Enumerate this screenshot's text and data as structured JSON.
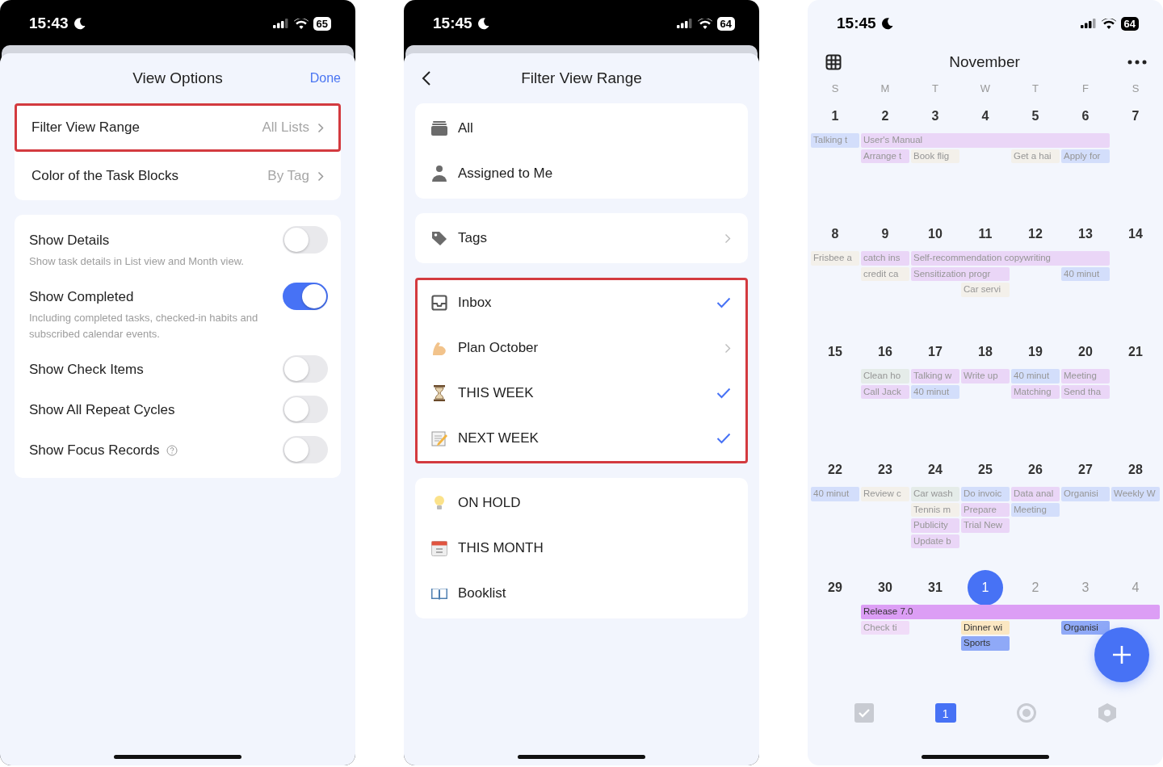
{
  "view_options": {
    "status_bar": {
      "time": "15:43",
      "battery": "65"
    },
    "title": "View Options",
    "done": "Done",
    "nav_rows": [
      {
        "label": "Filter View Range",
        "value": "All Lists",
        "highlighted": true
      },
      {
        "label": "Color of the Task Blocks",
        "value": "By Tag",
        "highlighted": false
      }
    ],
    "toggles": [
      {
        "label": "Show Details",
        "description": "Show task details in List view and Month view.",
        "on": false,
        "help": false
      },
      {
        "label": "Show Completed",
        "description": "Including completed tasks, checked-in habits and subscribed calendar events.",
        "on": true,
        "help": false
      },
      {
        "label": "Show Check Items",
        "on": false,
        "help": false
      },
      {
        "label": "Show All Repeat Cycles",
        "on": false,
        "help": false
      },
      {
        "label": "Show Focus Records",
        "on": false,
        "help": true
      }
    ]
  },
  "filter_view_range": {
    "status_bar": {
      "time": "15:45",
      "battery": "64"
    },
    "title": "Filter View Range",
    "groups": [
      {
        "highlighted": false,
        "items": [
          {
            "label": "All",
            "kind": "stack",
            "expandable": false,
            "selected": false
          },
          {
            "label": "Assigned to Me",
            "kind": "person",
            "expandable": false,
            "selected": false
          }
        ]
      },
      {
        "highlighted": false,
        "items": [
          {
            "label": "Tags",
            "kind": "tag",
            "expandable": true,
            "selected": false
          }
        ]
      },
      {
        "highlighted": true,
        "items": [
          {
            "label": "Inbox",
            "kind": "inbox",
            "expandable": false,
            "selected": true
          },
          {
            "label": "Plan October",
            "kind": "arm",
            "expandable": true,
            "selected": false
          },
          {
            "label": "THIS WEEK",
            "kind": "hourglass",
            "expandable": false,
            "selected": true
          },
          {
            "label": "NEXT WEEK",
            "kind": "memo",
            "expandable": false,
            "selected": true
          }
        ]
      },
      {
        "highlighted": false,
        "items": [
          {
            "label": "ON HOLD",
            "kind": "bulb",
            "expandable": false,
            "selected": false
          },
          {
            "label": "THIS MONTH",
            "kind": "calendar",
            "expandable": false,
            "selected": false
          },
          {
            "label": "Booklist",
            "kind": "book",
            "expandable": false,
            "selected": false
          }
        ]
      }
    ]
  },
  "calendar": {
    "status_bar": {
      "time": "15:45",
      "battery": "64"
    },
    "month": "November",
    "weekdays": [
      "S",
      "M",
      "T",
      "W",
      "T",
      "F",
      "S"
    ],
    "weeks": [
      {
        "days": [
          {
            "label": "1",
            "muted": false,
            "today": false
          },
          {
            "label": "2",
            "muted": false,
            "today": false
          },
          {
            "label": "3",
            "muted": false,
            "today": false
          },
          {
            "label": "4",
            "muted": false,
            "today": false
          },
          {
            "label": "5",
            "muted": false,
            "today": false
          },
          {
            "label": "6",
            "muted": false,
            "today": false
          },
          {
            "label": "7",
            "muted": false,
            "today": false
          }
        ],
        "lanes": [
          [
            {
              "kind": "event",
              "title": "Talking t",
              "color": "#d3defb",
              "completed": true
            },
            {
              "kind": "event",
              "title": "User's Manual",
              "color": "#ead6f7",
              "completed": true
            },
            {
              "kind": "continued"
            },
            {
              "kind": "continued"
            },
            {
              "kind": "continued"
            },
            {
              "kind": "continued"
            },
            {
              "kind": "empty"
            }
          ],
          [
            {
              "kind": "empty"
            },
            {
              "kind": "event",
              "title": "Arrange t",
              "color": "#ead6f7",
              "completed": true
            },
            {
              "kind": "event",
              "title": "Book flig",
              "color": "#f3f0ea",
              "completed": true
            },
            {
              "kind": "empty"
            },
            {
              "kind": "event",
              "title": "Get a hai",
              "color": "#f3f0ea",
              "completed": true
            },
            {
              "kind": "event",
              "title": "Apply for",
              "color": "#d3defb",
              "completed": true
            },
            {
              "kind": "empty"
            }
          ]
        ]
      },
      {
        "days": [
          {
            "label": "8",
            "muted": false,
            "today": false
          },
          {
            "label": "9",
            "muted": false,
            "today": false
          },
          {
            "label": "10",
            "muted": false,
            "today": false
          },
          {
            "label": "11",
            "muted": false,
            "today": false
          },
          {
            "label": "12",
            "muted": false,
            "today": false
          },
          {
            "label": "13",
            "muted": false,
            "today": false
          },
          {
            "label": "14",
            "muted": false,
            "today": false
          }
        ],
        "lanes": [
          [
            {
              "kind": "event",
              "title": "Frisbee a",
              "color": "#f3f0ea",
              "completed": true
            },
            {
              "kind": "event",
              "title": "catch ins",
              "color": "#ead6f7",
              "completed": true
            },
            {
              "kind": "event",
              "title": "Self-recommendation copywriting",
              "color": "#ead6f7",
              "completed": true
            },
            {
              "kind": "continued"
            },
            {
              "kind": "continued"
            },
            {
              "kind": "continued"
            },
            {
              "kind": "empty"
            }
          ],
          [
            {
              "kind": "empty"
            },
            {
              "kind": "event",
              "title": "credit ca",
              "color": "#f3f0ea",
              "completed": true
            },
            {
              "kind": "event",
              "title": "Sensitization progr",
              "color": "#ead6f7",
              "completed": true
            },
            {
              "kind": "continued"
            },
            {
              "kind": "empty"
            },
            {
              "kind": "event",
              "title": "40 minut",
              "color": "#d3defb",
              "completed": true
            },
            {
              "kind": "empty"
            }
          ],
          [
            {
              "kind": "empty"
            },
            {
              "kind": "empty"
            },
            {
              "kind": "empty"
            },
            {
              "kind": "event",
              "title": "Car servi",
              "color": "#f3f0ea",
              "completed": true
            },
            {
              "kind": "empty"
            },
            {
              "kind": "empty"
            },
            {
              "kind": "empty"
            }
          ]
        ]
      },
      {
        "days": [
          {
            "label": "15",
            "muted": false,
            "today": false
          },
          {
            "label": "16",
            "muted": false,
            "today": false
          },
          {
            "label": "17",
            "muted": false,
            "today": false
          },
          {
            "label": "18",
            "muted": false,
            "today": false
          },
          {
            "label": "19",
            "muted": false,
            "today": false
          },
          {
            "label": "20",
            "muted": false,
            "today": false
          },
          {
            "label": "21",
            "muted": false,
            "today": false
          }
        ],
        "lanes": [
          [
            {
              "kind": "empty"
            },
            {
              "kind": "event",
              "title": "Clean ho",
              "color": "#e5ece9",
              "completed": true
            },
            {
              "kind": "event",
              "title": "Talking w",
              "color": "#ead6f7",
              "completed": true
            },
            {
              "kind": "event",
              "title": "Write up",
              "color": "#ead6f7",
              "completed": true
            },
            {
              "kind": "event",
              "title": "40 minut",
              "color": "#d3defb",
              "completed": true
            },
            {
              "kind": "event",
              "title": "Meeting",
              "color": "#ead6f7",
              "completed": true
            },
            {
              "kind": "empty"
            }
          ],
          [
            {
              "kind": "empty"
            },
            {
              "kind": "event",
              "title": "Call Jack",
              "color": "#ead6f7",
              "completed": true
            },
            {
              "kind": "event",
              "title": "40 minut",
              "color": "#d3defb",
              "completed": true
            },
            {
              "kind": "empty"
            },
            {
              "kind": "event",
              "title": "Matching",
              "color": "#ead6f7",
              "completed": true
            },
            {
              "kind": "event",
              "title": "Send tha",
              "color": "#ead6f7",
              "completed": true
            },
            {
              "kind": "empty"
            }
          ]
        ]
      },
      {
        "days": [
          {
            "label": "22",
            "muted": false,
            "today": false
          },
          {
            "label": "23",
            "muted": false,
            "today": false
          },
          {
            "label": "24",
            "muted": false,
            "today": false
          },
          {
            "label": "25",
            "muted": false,
            "today": false
          },
          {
            "label": "26",
            "muted": false,
            "today": false
          },
          {
            "label": "27",
            "muted": false,
            "today": false
          },
          {
            "label": "28",
            "muted": false,
            "today": false
          }
        ],
        "lanes": [
          [
            {
              "kind": "event",
              "title": "40 minut",
              "color": "#d3defb",
              "completed": true
            },
            {
              "kind": "event",
              "title": "Review c",
              "color": "#f3f0ea",
              "completed": true
            },
            {
              "kind": "event",
              "title": "Car wash",
              "color": "#e5ece9",
              "completed": true
            },
            {
              "kind": "event",
              "title": "Do invoic",
              "color": "#d3defb",
              "completed": true
            },
            {
              "kind": "event",
              "title": "Data anal",
              "color": "#ead6f7",
              "completed": true
            },
            {
              "kind": "event",
              "title": "Organisi",
              "color": "#d3defb",
              "completed": true
            },
            {
              "kind": "event",
              "title": "Weekly W",
              "color": "#d3defb",
              "completed": true
            }
          ],
          [
            {
              "kind": "empty"
            },
            {
              "kind": "empty"
            },
            {
              "kind": "event",
              "title": "Tennis m",
              "color": "#f3f0ea",
              "completed": true
            },
            {
              "kind": "event",
              "title": "Prepare",
              "color": "#ead6f7",
              "completed": true
            },
            {
              "kind": "event",
              "title": "Meeting",
              "color": "#d3defb",
              "completed": true
            },
            {
              "kind": "empty"
            },
            {
              "kind": "empty"
            }
          ],
          [
            {
              "kind": "empty"
            },
            {
              "kind": "empty"
            },
            {
              "kind": "event",
              "title": "Publicity",
              "color": "#ead6f7",
              "completed": true
            },
            {
              "kind": "event",
              "title": "Trial New",
              "color": "#ead6f7",
              "completed": true
            },
            {
              "kind": "empty"
            },
            {
              "kind": "empty"
            },
            {
              "kind": "empty"
            }
          ],
          [
            {
              "kind": "empty"
            },
            {
              "kind": "empty"
            },
            {
              "kind": "event",
              "title": "Update b",
              "color": "#ead6f7",
              "completed": true
            },
            {
              "kind": "empty"
            },
            {
              "kind": "empty"
            },
            {
              "kind": "empty"
            },
            {
              "kind": "empty"
            }
          ]
        ]
      },
      {
        "days": [
          {
            "label": "29",
            "muted": false,
            "today": false
          },
          {
            "label": "30",
            "muted": false,
            "today": false
          },
          {
            "label": "31",
            "muted": false,
            "today": false
          },
          {
            "label": "1",
            "muted": false,
            "today": true
          },
          {
            "label": "2",
            "muted": true,
            "today": false
          },
          {
            "label": "3",
            "muted": true,
            "today": false
          },
          {
            "label": "4",
            "muted": true,
            "today": false
          }
        ],
        "lanes": [
          [
            {
              "kind": "empty"
            },
            {
              "kind": "event",
              "title": "Release 7.0",
              "color": "#dc9ef5",
              "completed": false
            },
            {
              "kind": "continued"
            },
            {
              "kind": "continued"
            },
            {
              "kind": "continued"
            },
            {
              "kind": "continued"
            },
            {
              "kind": "continued"
            }
          ],
          [
            {
              "kind": "empty"
            },
            {
              "kind": "event",
              "title": "Check ti",
              "color": "#f0dcf8",
              "completed": true
            },
            {
              "kind": "empty"
            },
            {
              "kind": "event",
              "title": "Dinner wi",
              "color": "#fbe7c2",
              "completed": false
            },
            {
              "kind": "empty"
            },
            {
              "kind": "event",
              "title": "Organisi",
              "color": "#8fa9f7",
              "completed": false
            },
            {
              "kind": "empty"
            }
          ],
          [
            {
              "kind": "empty"
            },
            {
              "kind": "empty"
            },
            {
              "kind": "empty"
            },
            {
              "kind": "event",
              "title": "Sports",
              "color": "#8fa9f7",
              "completed": false
            },
            {
              "kind": "empty"
            },
            {
              "kind": "empty"
            },
            {
              "kind": "empty"
            }
          ]
        ]
      }
    ],
    "tabs": [
      {
        "kind": "check",
        "selected": false
      },
      {
        "kind": "calendar",
        "label": "1",
        "selected": true
      },
      {
        "kind": "target",
        "selected": false
      },
      {
        "kind": "hexagon",
        "selected": false
      }
    ]
  }
}
